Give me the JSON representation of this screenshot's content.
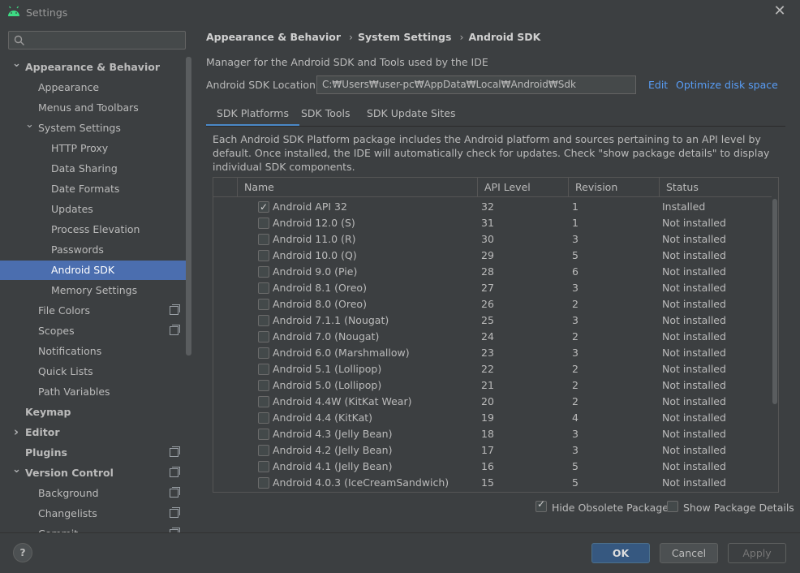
{
  "window": {
    "title": "Settings",
    "icon": "android-icon",
    "close_glyph": "✕"
  },
  "search": {
    "placeholder": "",
    "icon": "search-icon"
  },
  "sidebar": {
    "items": [
      {
        "label": "Appearance & Behavior",
        "level": 0,
        "arrow": "expanded",
        "bold": true
      },
      {
        "label": "Appearance",
        "level": 1
      },
      {
        "label": "Menus and Toolbars",
        "level": 1
      },
      {
        "label": "System Settings",
        "level": 1,
        "arrow": "expanded"
      },
      {
        "label": "HTTP Proxy",
        "level": 2
      },
      {
        "label": "Data Sharing",
        "level": 2
      },
      {
        "label": "Date Formats",
        "level": 2
      },
      {
        "label": "Updates",
        "level": 2
      },
      {
        "label": "Process Elevation",
        "level": 2
      },
      {
        "label": "Passwords",
        "level": 2
      },
      {
        "label": "Android SDK",
        "level": 2,
        "selected": true
      },
      {
        "label": "Memory Settings",
        "level": 2
      },
      {
        "label": "File Colors",
        "level": 1,
        "project_icon": true
      },
      {
        "label": "Scopes",
        "level": 1,
        "project_icon": true
      },
      {
        "label": "Notifications",
        "level": 1
      },
      {
        "label": "Quick Lists",
        "level": 1
      },
      {
        "label": "Path Variables",
        "level": 1
      },
      {
        "label": "Keymap",
        "level": 0,
        "bold": true
      },
      {
        "label": "Editor",
        "level": 0,
        "arrow": "collapsed",
        "bold": true
      },
      {
        "label": "Plugins",
        "level": 0,
        "bold": true,
        "project_icon": true
      },
      {
        "label": "Version Control",
        "level": 0,
        "arrow": "expanded",
        "bold": true,
        "project_icon": true
      },
      {
        "label": "Background",
        "level": 1,
        "project_icon": true
      },
      {
        "label": "Changelists",
        "level": 1,
        "project_icon": true
      },
      {
        "label": "Commit",
        "level": 1,
        "project_icon": true
      }
    ]
  },
  "breadcrumb": [
    "Appearance & Behavior",
    "System Settings",
    "Android SDK"
  ],
  "main": {
    "description": "Manager for the Android SDK and Tools used by the IDE",
    "sdk_location_label": "Android SDK Location:",
    "sdk_location_value": "C:₩Users₩user-pc₩AppData₩Local₩Android₩Sdk",
    "edit_link": "Edit",
    "optimize_link": "Optimize disk space",
    "tabs": [
      {
        "label": "SDK Platforms",
        "active": true
      },
      {
        "label": "SDK Tools"
      },
      {
        "label": "SDK Update Sites"
      }
    ],
    "platform_description": "Each Android SDK Platform package includes the Android platform and sources pertaining to an API level by default. Once installed, the IDE will automatically check for updates. Check \"show package details\" to display individual SDK components."
  },
  "table": {
    "columns": [
      "Name",
      "API Level",
      "Revision",
      "Status"
    ],
    "rows": [
      {
        "checked": true,
        "name": "Android API 32",
        "api": "32",
        "rev": "1",
        "status": "Installed"
      },
      {
        "checked": false,
        "name": "Android 12.0 (S)",
        "api": "31",
        "rev": "1",
        "status": "Not installed"
      },
      {
        "checked": false,
        "name": "Android 11.0 (R)",
        "api": "30",
        "rev": "3",
        "status": "Not installed"
      },
      {
        "checked": false,
        "name": "Android 10.0 (Q)",
        "api": "29",
        "rev": "5",
        "status": "Not installed"
      },
      {
        "checked": false,
        "name": "Android 9.0 (Pie)",
        "api": "28",
        "rev": "6",
        "status": "Not installed"
      },
      {
        "checked": false,
        "name": "Android 8.1 (Oreo)",
        "api": "27",
        "rev": "3",
        "status": "Not installed"
      },
      {
        "checked": false,
        "name": "Android 8.0 (Oreo)",
        "api": "26",
        "rev": "2",
        "status": "Not installed"
      },
      {
        "checked": false,
        "name": "Android 7.1.1 (Nougat)",
        "api": "25",
        "rev": "3",
        "status": "Not installed"
      },
      {
        "checked": false,
        "name": "Android 7.0 (Nougat)",
        "api": "24",
        "rev": "2",
        "status": "Not installed"
      },
      {
        "checked": false,
        "name": "Android 6.0 (Marshmallow)",
        "api": "23",
        "rev": "3",
        "status": "Not installed"
      },
      {
        "checked": false,
        "name": "Android 5.1 (Lollipop)",
        "api": "22",
        "rev": "2",
        "status": "Not installed"
      },
      {
        "checked": false,
        "name": "Android 5.0 (Lollipop)",
        "api": "21",
        "rev": "2",
        "status": "Not installed"
      },
      {
        "checked": false,
        "name": "Android 4.4W (KitKat Wear)",
        "api": "20",
        "rev": "2",
        "status": "Not installed"
      },
      {
        "checked": false,
        "name": "Android 4.4 (KitKat)",
        "api": "19",
        "rev": "4",
        "status": "Not installed"
      },
      {
        "checked": false,
        "name": "Android 4.3 (Jelly Bean)",
        "api": "18",
        "rev": "3",
        "status": "Not installed"
      },
      {
        "checked": false,
        "name": "Android 4.2 (Jelly Bean)",
        "api": "17",
        "rev": "3",
        "status": "Not installed"
      },
      {
        "checked": false,
        "name": "Android 4.1 (Jelly Bean)",
        "api": "16",
        "rev": "5",
        "status": "Not installed"
      },
      {
        "checked": false,
        "name": "Android 4.0.3 (IceCreamSandwich)",
        "api": "15",
        "rev": "5",
        "status": "Not installed"
      }
    ]
  },
  "options": {
    "hide_obsolete": {
      "label": "Hide Obsolete Packages",
      "checked": true
    },
    "show_details": {
      "label": "Show Package Details",
      "checked": false
    }
  },
  "footer": {
    "help": "?",
    "ok": "OK",
    "cancel": "Cancel",
    "apply": "Apply"
  },
  "colors": {
    "background": "#3c3f41",
    "selection": "#4b6eaf",
    "link": "#589df6",
    "ok_button": "#365880"
  }
}
